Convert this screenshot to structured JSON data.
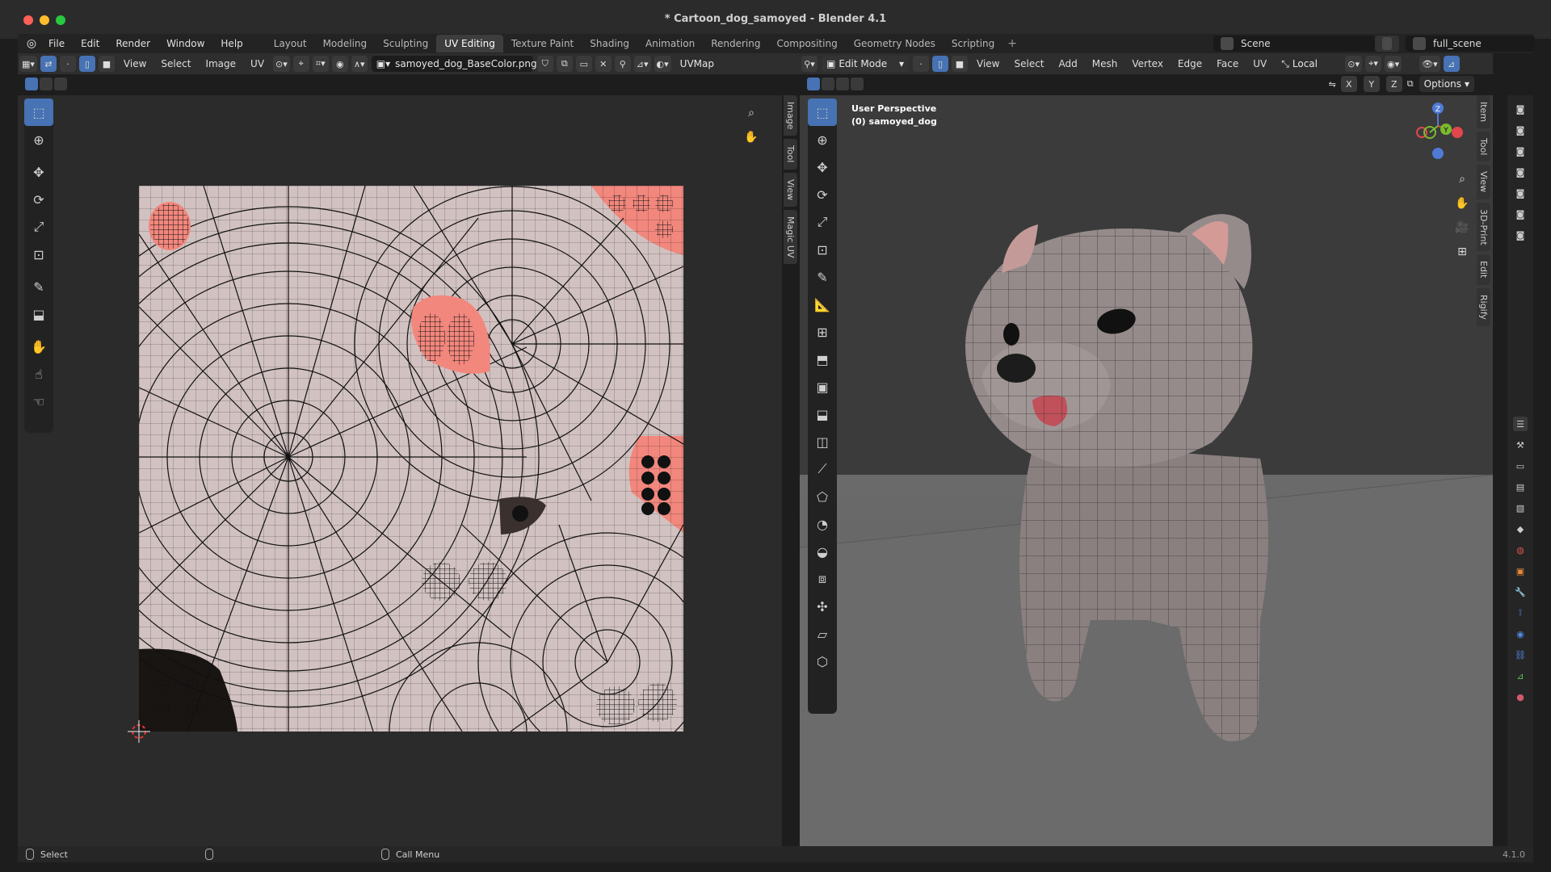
{
  "window": {
    "title": "* Cartoon_dog_samoyed - Blender 4.1"
  },
  "menu": [
    "File",
    "Edit",
    "Render",
    "Window",
    "Help"
  ],
  "workspaces": [
    "Layout",
    "Modeling",
    "Sculpting",
    "UV Editing",
    "Texture Paint",
    "Shading",
    "Animation",
    "Rendering",
    "Compositing",
    "Geometry Nodes",
    "Scripting"
  ],
  "active_workspace": "UV Editing",
  "scene": {
    "name": "Scene",
    "view_layer": "full_scene"
  },
  "uv_header": {
    "menus": [
      "View",
      "Select",
      "Image",
      "UV"
    ],
    "image_name": "samoyed_dog_BaseColor.png",
    "uvmap": "UVMap"
  },
  "uv_sidebar_tabs": [
    "Image",
    "Tool",
    "View",
    "Magic UV"
  ],
  "vp_header": {
    "mode": "Edit Mode",
    "menus": [
      "View",
      "Select",
      "Add",
      "Mesh",
      "Vertex",
      "Edge",
      "Face",
      "UV"
    ],
    "orientation": "Local",
    "options": "Options",
    "axes": [
      "X",
      "Y",
      "Z"
    ]
  },
  "viewport_overlay": {
    "line1": "User Perspective",
    "line2": "(0) samoyed_dog"
  },
  "vp_sidebar_tabs": [
    "Item",
    "Tool",
    "View",
    "3D-Print",
    "Edit",
    "Rigify"
  ],
  "gizmo": {
    "z": "Z",
    "y": "Y"
  },
  "status": {
    "left": "Select",
    "middle": "Call Menu",
    "version": "4.1.0"
  },
  "icons": [
    "search-icon",
    "hand-icon",
    "cursor-icon",
    "move-icon",
    "rotate-icon",
    "scale-icon",
    "transform-icon",
    "annotate-icon",
    "camera-icon"
  ],
  "colors": {
    "accent": "#4772b3",
    "uv_bg": "#d1c2c1",
    "pink": "#f2877d"
  }
}
